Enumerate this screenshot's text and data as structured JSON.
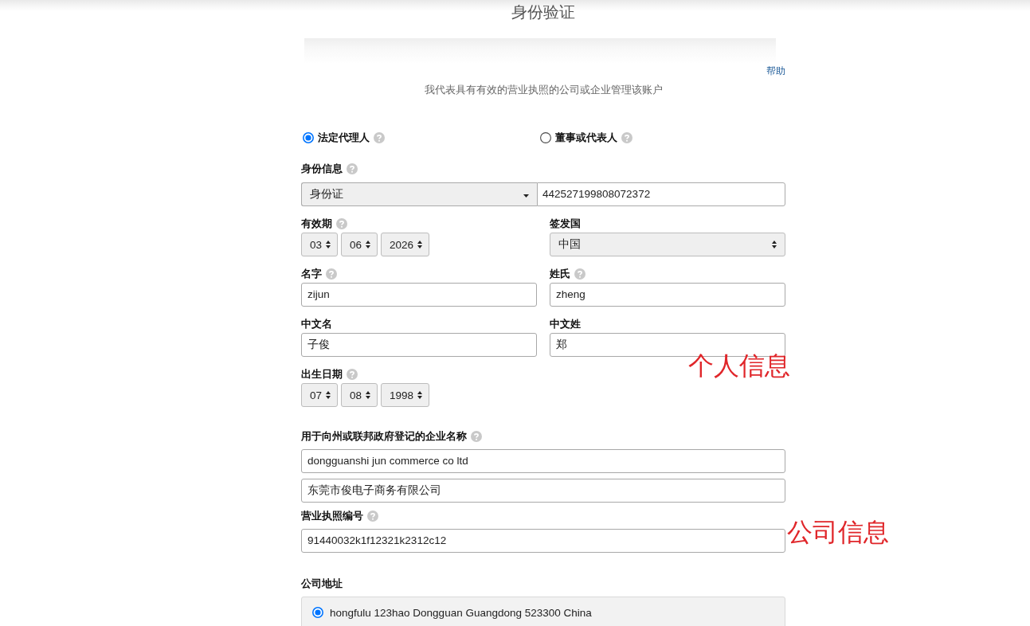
{
  "header": {
    "title": "身份验证"
  },
  "help_link": "帮助",
  "subtitle": "我代表具有有效的营业执照的公司或企业管理该账户",
  "role_options": [
    {
      "label": "法定代理人",
      "selected": true,
      "help": true
    },
    {
      "label": "董事或代表人",
      "selected": false,
      "help": true
    }
  ],
  "identity": {
    "label": "身份信息",
    "help": true,
    "document_type": "身份证",
    "document_number": "442527199808072372"
  },
  "personal_rows": [
    {
      "fields": [
        {
          "kind": "date",
          "label": "有效期",
          "help": true,
          "parts": [
            "03",
            "06",
            "2026"
          ]
        },
        {
          "kind": "select",
          "label": "签发国",
          "help": false,
          "value": "中国"
        }
      ]
    },
    {
      "fields": [
        {
          "kind": "input",
          "label": "名字",
          "help": true,
          "value": "zijun"
        },
        {
          "kind": "input",
          "label": "姓氏",
          "help": true,
          "value": "zheng"
        }
      ]
    },
    {
      "fields": [
        {
          "kind": "input",
          "label": "中文名",
          "help": false,
          "value": "子俊"
        },
        {
          "kind": "input",
          "label": "中文姓",
          "help": false,
          "value": "郑"
        }
      ]
    },
    {
      "fields": [
        {
          "kind": "date",
          "label": "出生日期",
          "help": true,
          "parts": [
            "07",
            "08",
            "1998"
          ]
        }
      ],
      "annotation": "个人信息"
    }
  ],
  "business_name": {
    "label": "用于向州或联邦政府登记的企业名称",
    "help": true,
    "values": [
      "dongguanshi jun commerce co ltd",
      "东莞市俊电子商务有限公司"
    ]
  },
  "license_number": {
    "label": "营业执照编号",
    "help": true,
    "value": "91440032k1f12321k2312c12",
    "annotation": "公司信息"
  },
  "company_address": {
    "label": "公司地址",
    "options": [
      {
        "text": "hongfulu 123hao Dongguan Guangdong 523300 China",
        "selected": true
      }
    ]
  }
}
